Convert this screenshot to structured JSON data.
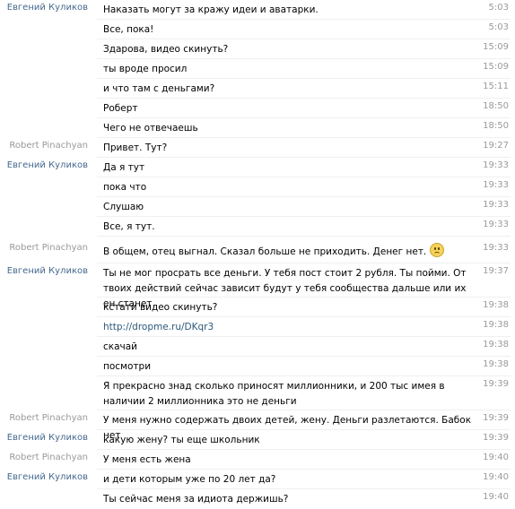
{
  "messages": [
    {
      "sender": "Евгений Куликов",
      "senderType": "blue",
      "text": "Наказать могут за кражу идеи и аватарки.",
      "time": "5:03"
    },
    {
      "sender": "",
      "text": "Все, пока!",
      "time": "5:03"
    },
    {
      "sender": "",
      "text": "Здарова, видео скинуть?",
      "time": "15:09"
    },
    {
      "sender": "",
      "text": "ты вроде просил",
      "time": "15:09"
    },
    {
      "sender": "",
      "text": "и что там с деньгами?",
      "time": "15:11"
    },
    {
      "sender": "",
      "text": "Роберт",
      "time": "18:50"
    },
    {
      "sender": "",
      "text": "Чего не отвечаешь",
      "time": "18:50"
    },
    {
      "sender": "Robert Pinachyan",
      "senderType": "gray",
      "text": "Привет. Тут?",
      "time": "19:27"
    },
    {
      "sender": "Евгений Куликов",
      "senderType": "blue",
      "text": "Да я тут",
      "time": "19:33"
    },
    {
      "sender": "",
      "text": "пока что",
      "time": "19:33"
    },
    {
      "sender": "",
      "text": "Слушаю",
      "time": "19:33"
    },
    {
      "sender": "",
      "text": "Все, я тут.",
      "time": "19:33"
    },
    {
      "sender": "Robert Pinachyan",
      "senderType": "gray",
      "text": "В общем, отец выгнал. Сказал больше не приходить. Денег нет.",
      "emoji": "sad-emoji",
      "time": "19:33"
    },
    {
      "sender": "Евгений Куликов",
      "senderType": "blue",
      "text": "Ты не мог просрать все деньги. У тебя пост стоит 2 рубля. Ты пойми. От твоих действий сейчас зависит будут у тебя сообщества дальше или их ен станет",
      "time": "19:37"
    },
    {
      "sender": "",
      "text": "кстати видео скинуть?",
      "time": "19:38"
    },
    {
      "sender": "",
      "text": "http://dropme.ru/DKqr3",
      "isLink": true,
      "time": "19:38"
    },
    {
      "sender": "",
      "text": "скачай",
      "time": "19:38"
    },
    {
      "sender": "",
      "text": "посмотри",
      "time": "19:38"
    },
    {
      "sender": "",
      "text": "Я прекрасно знад сколько приносят миллионники, и 200 тыс имея в наличии 2 миллионника это не деньги",
      "time": "19:39"
    },
    {
      "sender": "Robert Pinachyan",
      "senderType": "gray",
      "text": "У меня нужно содержать двоих детей, жену. Деньги разлетаются. Бабок нет",
      "time": "19:39"
    },
    {
      "sender": "Евгений Куликов",
      "senderType": "blue",
      "text": "какую жену? ты еще школьник",
      "time": "19:39"
    },
    {
      "sender": "Robert Pinachyan",
      "senderType": "gray",
      "text": "У меня есть жена",
      "time": "19:40"
    },
    {
      "sender": "Евгений Куликов",
      "senderType": "blue",
      "text": "и дети которым уже по 20 лет да?",
      "time": "19:40"
    },
    {
      "sender": "",
      "text": "Ты сейчас меня за идиота держишь?",
      "time": "19:40"
    }
  ]
}
